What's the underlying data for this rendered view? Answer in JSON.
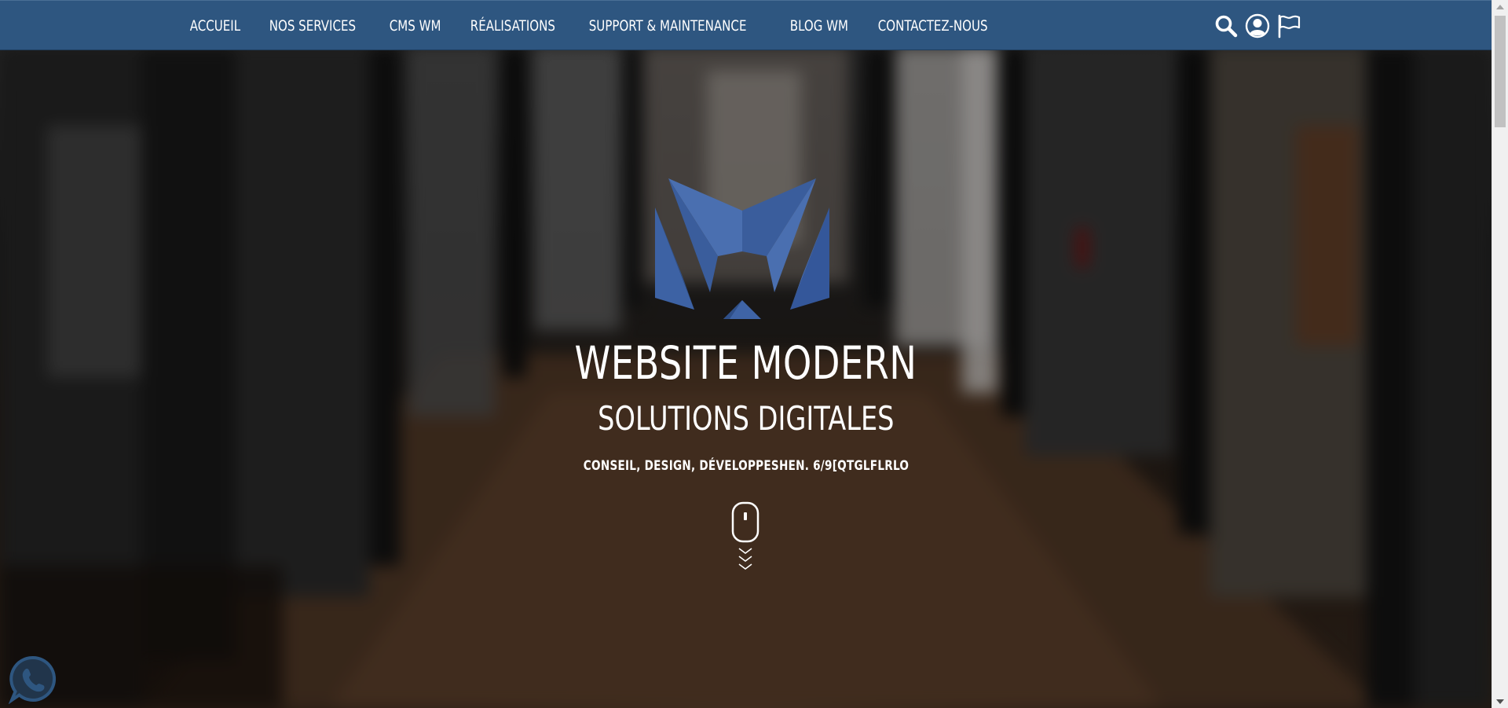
{
  "nav": {
    "items": [
      {
        "label": "ACCUEIL"
      },
      {
        "label": "NOS SERVICES"
      },
      {
        "label": "CMS WM"
      },
      {
        "label": "RÉALISATIONS"
      },
      {
        "label": "SUPPORT & MAINTENANCE"
      },
      {
        "label": "BLOG WM"
      },
      {
        "label": "CONTACTEZ-NOUS"
      }
    ],
    "icons": [
      "search-icon",
      "user-account-icon",
      "flag-icon"
    ]
  },
  "hero": {
    "title": "WEBSITE MODERN",
    "subtitle": "SOLUTIONS DIGITALES",
    "tagline": "CONSEIL, DESIGN, DÉVELOPPESHEN. 6/9[QTGLFLRLO"
  },
  "colors": {
    "navbar": "#2e5680",
    "logo_light": "#4a6fb0",
    "logo_dark": "#34558f",
    "text": "#ffffff"
  }
}
